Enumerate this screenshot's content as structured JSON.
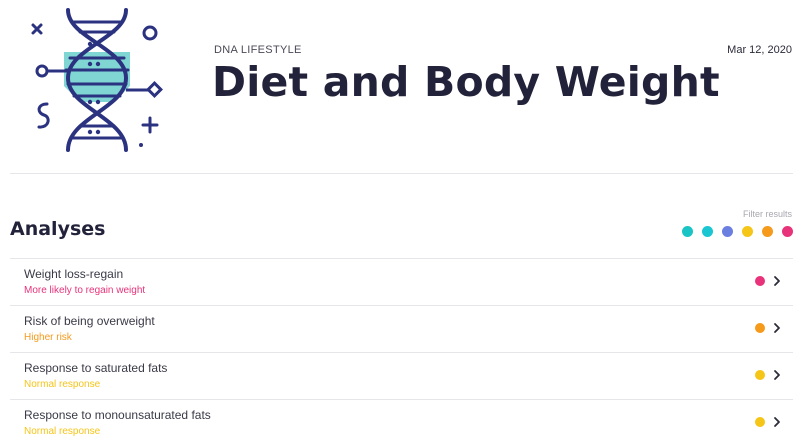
{
  "header": {
    "kicker": "DNA LIFESTYLE",
    "title": "Diet and Body Weight",
    "date": "Mar 12, 2020",
    "illustration_icon": "dna-helix-icon"
  },
  "analyses": {
    "title": "Analyses",
    "filter_label": "Filter results",
    "filters": [
      {
        "color": "#1bc4c4"
      },
      {
        "color": "#19c6d2"
      },
      {
        "color": "#6b7fe0"
      },
      {
        "color": "#f5c518"
      },
      {
        "color": "#f59a1b"
      },
      {
        "color": "#e8337a"
      }
    ],
    "items": [
      {
        "title": "Weight loss-regain",
        "subtitle": "More likely to regain weight",
        "color": "#e8337a"
      },
      {
        "title": "Risk of being overweight",
        "subtitle": "Higher risk",
        "color": "#f59a1b"
      },
      {
        "title": "Response to saturated fats",
        "subtitle": "Normal response",
        "color": "#f5c518"
      },
      {
        "title": "Response to monounsaturated fats",
        "subtitle": "Normal response",
        "color": "#f5c518"
      }
    ]
  },
  "colors": {
    "accent_teal": "#6fd3d3",
    "navy": "#2b3280"
  }
}
